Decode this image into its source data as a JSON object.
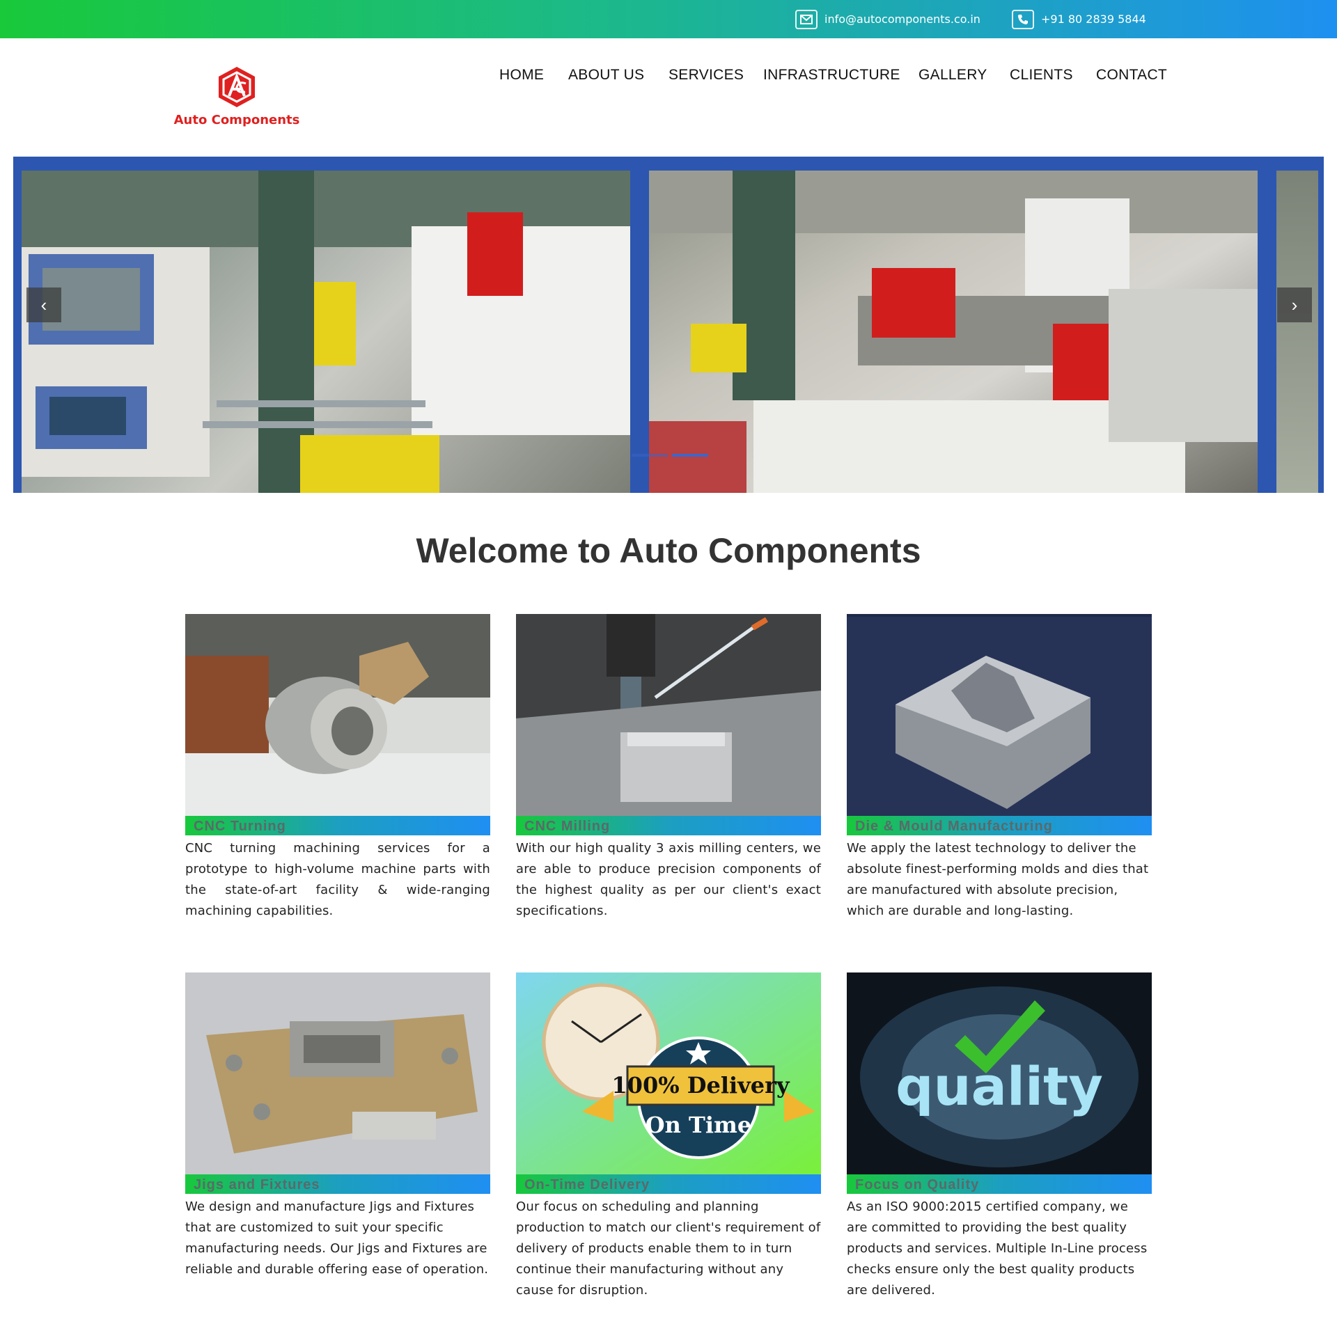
{
  "topbar": {
    "email": "info@autocomponents.co.in",
    "phone": "+91 80 2839 5844",
    "email_icon": "envelope-icon",
    "phone_icon": "phone-icon"
  },
  "brand": {
    "logo_text": "Auto Components",
    "logo_icon": "hexagon-ac-logo"
  },
  "nav": {
    "items": [
      "HOME",
      "ABOUT US",
      "SERVICES",
      "INFRASTRUCTURE",
      "GALLERY",
      "CLIENTS",
      "CONTACT"
    ]
  },
  "hero": {
    "prev_icon": "chevron-left-icon",
    "next_icon": "chevron-right-icon",
    "prev_glyph": "‹",
    "next_glyph": "›",
    "slide_count": 2,
    "active_slide": 2
  },
  "welcome": {
    "title": "Welcome to Auto Components"
  },
  "services": [
    {
      "title": "CNC Turning",
      "description": "CNC turning machining services for a prototype to high-volume machine parts with the state-of-art facility & wide-ranging machining capabilities."
    },
    {
      "title": "CNC Milling",
      "description": "With our high quality 3 axis milling centers, we are able to produce precision components of the highest quality as per our client's exact specifications."
    },
    {
      "title": "Die & Mould Manufacturing",
      "description": "We apply the latest technology to deliver the absolute finest-performing molds and dies that are manufactured with absolute precision, which are durable and long-lasting."
    },
    {
      "title": "Jigs and Fixtures",
      "description": "We design and manufacture Jigs and Fixtures that are customized to suit your specific manufacturing needs. Our Jigs and Fixtures are reliable and durable offering ease of operation."
    },
    {
      "title": "On-Time Delivery",
      "description": "Our focus on scheduling and planning production to match our client's requirement of delivery of products enable them to in turn continue their manufacturing without any cause for disruption.",
      "badge_line1": "100% Delivery",
      "badge_line2": "On Time"
    },
    {
      "title": "Focus on Quality",
      "description": "As an ISO 9000:2015 certified company, we are committed to providing the best quality products and services. Multiple In-Line process checks ensure only the best quality products are delivered.",
      "badge_word": "quality"
    }
  ],
  "colors": {
    "topbar_start": "#19c93a",
    "topbar_end": "#1e90f0",
    "hero_frame": "#2c56b0",
    "logo_red": "#e02020"
  }
}
